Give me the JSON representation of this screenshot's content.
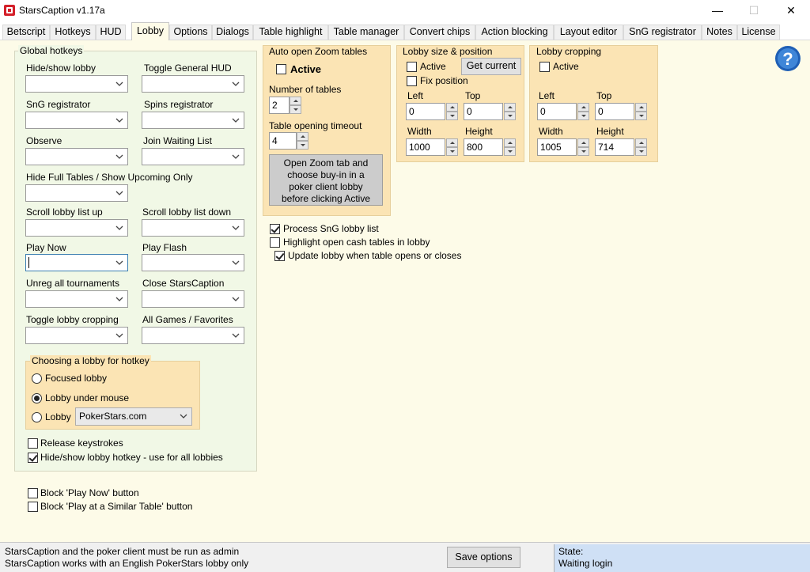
{
  "window": {
    "title": "StarsCaption v1.17a",
    "minimize_glyph": "—",
    "maximize_glyph": "☐",
    "close_glyph": "✕"
  },
  "tabs": [
    {
      "label": "Betscript"
    },
    {
      "label": "Hotkeys"
    },
    {
      "label": "HUD"
    },
    {
      "label": "Lobby"
    },
    {
      "label": "Options"
    },
    {
      "label": "Dialogs"
    },
    {
      "label": "Table highlight"
    },
    {
      "label": "Table manager"
    },
    {
      "label": "Convert chips"
    },
    {
      "label": "Action blocking"
    },
    {
      "label": "Layout editor"
    },
    {
      "label": "SnG registrator"
    },
    {
      "label": "Notes"
    },
    {
      "label": "License"
    }
  ],
  "active_tab": "Lobby",
  "global_hotkeys": {
    "title": "Global hotkeys",
    "fields": [
      {
        "label": "Hide/show lobby",
        "value": ""
      },
      {
        "label": "Toggle General HUD",
        "value": ""
      },
      {
        "label": "SnG registrator",
        "value": ""
      },
      {
        "label": "Spins registrator",
        "value": ""
      },
      {
        "label": "Observe",
        "value": ""
      },
      {
        "label": "Join Waiting List",
        "value": ""
      },
      {
        "label": "Hide Full Tables / Show Upcoming Only",
        "value": ""
      },
      {
        "label": "Scroll lobby list up",
        "value": ""
      },
      {
        "label": "Scroll lobby list down",
        "value": ""
      },
      {
        "label": "Play Now",
        "value": ""
      },
      {
        "label": "Play Flash",
        "value": ""
      },
      {
        "label": "Unreg all tournaments",
        "value": ""
      },
      {
        "label": "Close StarsCaption",
        "value": ""
      },
      {
        "label": "Toggle lobby cropping",
        "value": ""
      },
      {
        "label": "All Games / Favorites",
        "value": ""
      }
    ],
    "lobby_choice": {
      "title": "Choosing a lobby for hotkey",
      "options": [
        "Focused lobby",
        "Lobby under mouse",
        "Lobby"
      ],
      "selected": "Lobby under mouse",
      "lobby_select_value": "PokerStars.com"
    },
    "release_keystrokes": {
      "label": "Release keystrokes",
      "checked": false
    },
    "hide_show_all": {
      "label": "Hide/show lobby hotkey - use for all lobbies",
      "checked": true
    }
  },
  "block_play_now": {
    "label": "Block 'Play Now' button",
    "checked": false
  },
  "block_similar": {
    "label": "Block 'Play at a Similar Table' button",
    "checked": false
  },
  "auto_zoom": {
    "title": "Auto open Zoom tables",
    "active_label": "Active",
    "active": false,
    "num_tables_label": "Number of tables",
    "num_tables": "2",
    "timeout_label": "Table opening timeout",
    "timeout": "4",
    "hint_button": "Open Zoom tab and choose buy-in in a poker client lobby before clicking Active"
  },
  "lobby_size": {
    "title": "Lobby size & position",
    "active_label": "Active",
    "active": false,
    "get_current": "Get current",
    "fix_label": "Fix position",
    "fix": false,
    "left_label": "Left",
    "left": "0",
    "top_label": "Top",
    "top": "0",
    "width_label": "Width",
    "width": "1000",
    "height_label": "Height",
    "height": "800"
  },
  "lobby_cropping": {
    "title": "Lobby cropping",
    "active_label": "Active",
    "active": false,
    "left_label": "Left",
    "left": "0",
    "top_label": "Top",
    "top": "0",
    "width_label": "Width",
    "width": "1005",
    "height_label": "Height",
    "height": "714"
  },
  "options": {
    "process_sng": {
      "label": "Process SnG lobby list",
      "checked": true
    },
    "highlight_cash": {
      "label": "Highlight open cash tables in lobby",
      "checked": false
    },
    "update_lobby": {
      "label": "Update lobby when table opens or closes",
      "checked": true
    }
  },
  "status": {
    "line1": "StarsCaption and the poker client must be run as admin",
    "line2": "StarsCaption works with an English PokerStars lobby only",
    "save_button": "Save options",
    "state_label": "State:",
    "state_value": "Waiting login"
  },
  "colors": {
    "panel_bg": "#fdfbe8",
    "global_group_bg": "#f1f8e6",
    "orange_group_bg": "#fbe4b4",
    "status_state_bg": "#cfe0f5",
    "help_icon": "#1f5fb5"
  },
  "icons": {
    "app": "starscaption-logo-icon",
    "help": "question-mark-icon",
    "combo": "chevron-down-icon"
  }
}
